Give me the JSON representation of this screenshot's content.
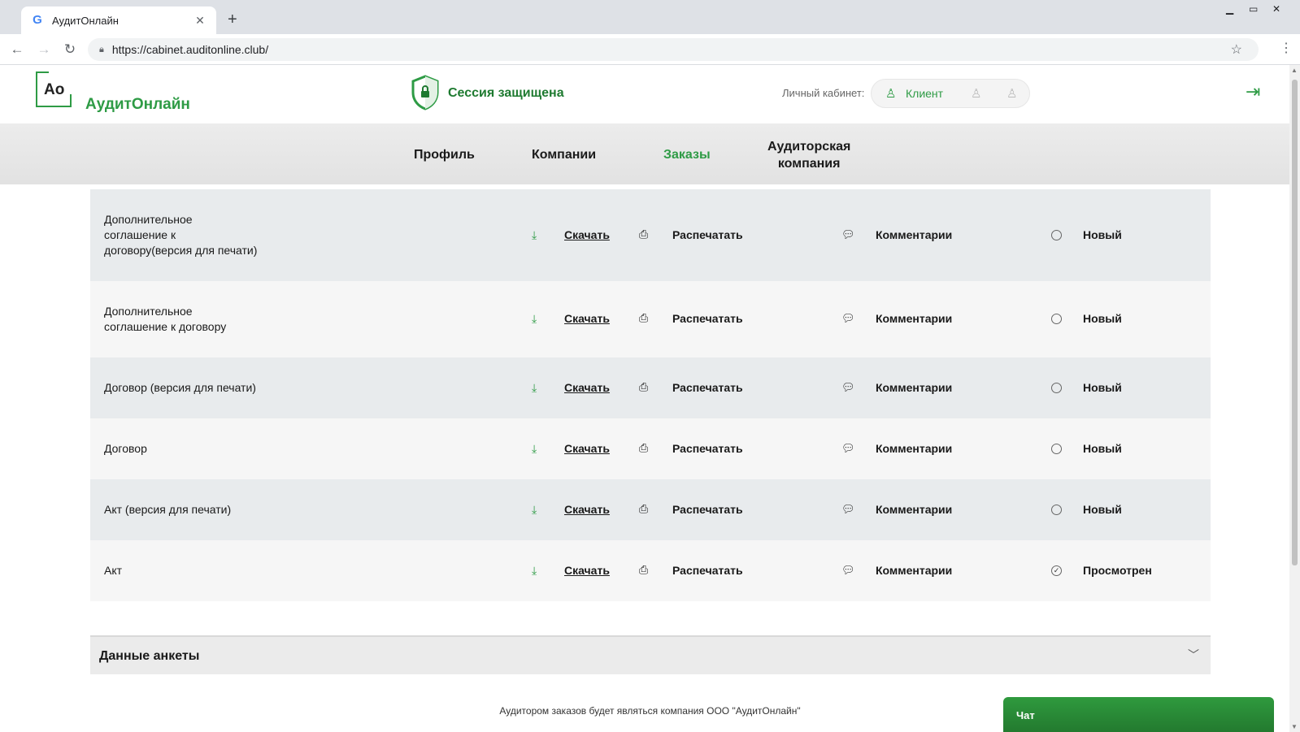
{
  "browser": {
    "tab_title": "АудитОнлайн",
    "url": "https://cabinet.auditonline.club/"
  },
  "header": {
    "logo_mark": "Ao",
    "logo_text": "АудитОнлайн",
    "session_text": "Сессия защищена",
    "cabinet_label": "Личный кабинет:",
    "role_active": "Клиент",
    "brand_color": "#2e9b45"
  },
  "menu": {
    "profile": "Профиль",
    "companies": "Компании",
    "orders": "Заказы",
    "audit_company_line1": "Аудиторская",
    "audit_company_line2": "компания"
  },
  "documents": {
    "download_label": "Скачать",
    "print_label": "Распечатать",
    "comments_label": "Комментарии",
    "rows": [
      {
        "name_lines": [
          "Дополнительное",
          "соглашение к",
          "договору(версия для печати)"
        ],
        "status": "Новый",
        "viewed": false
      },
      {
        "name_lines": [
          "Дополнительное",
          "соглашение к договору"
        ],
        "status": "Новый",
        "viewed": false
      },
      {
        "name_lines": [
          "Договор (версия для печати)"
        ],
        "status": "Новый",
        "viewed": false
      },
      {
        "name_lines": [
          "Договор"
        ],
        "status": "Новый",
        "viewed": false
      },
      {
        "name_lines": [
          "Акт (версия для печати)"
        ],
        "status": "Новый",
        "viewed": false
      },
      {
        "name_lines": [
          "Акт"
        ],
        "status": "Просмотрен",
        "viewed": true
      }
    ]
  },
  "accordion": {
    "title": "Данные анкеты"
  },
  "footer": {
    "note": "Аудитором заказов будет являться компания ООО \"АудитОнлайн\""
  },
  "chat": {
    "label": "Чат"
  }
}
